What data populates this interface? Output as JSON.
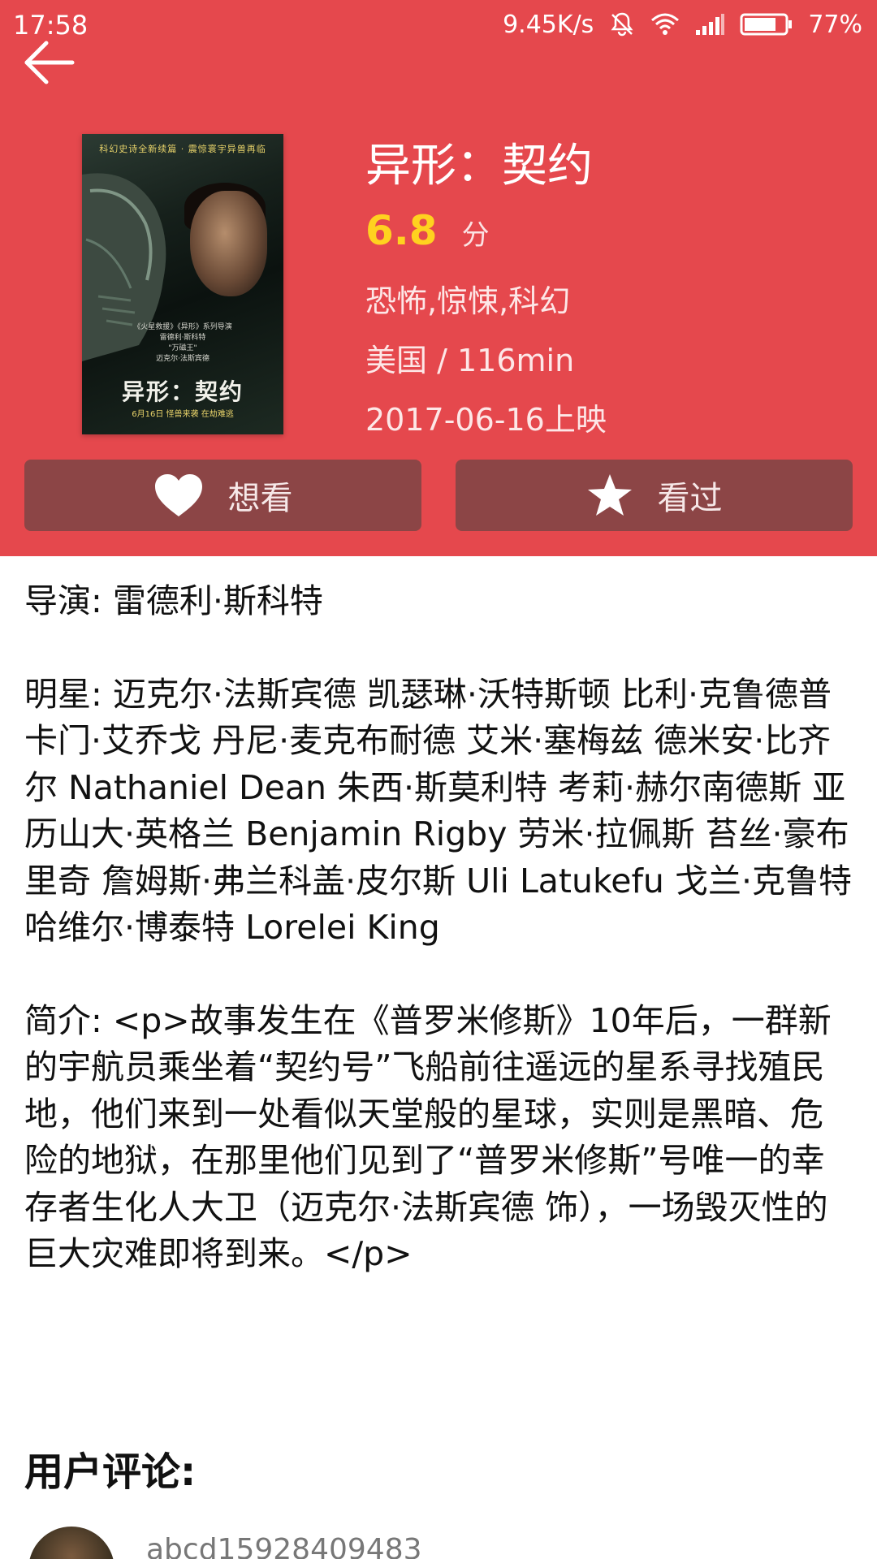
{
  "status_bar": {
    "time": "17:58",
    "net_speed": "9.45K/s",
    "battery": "77%"
  },
  "movie": {
    "title": "异形：契约",
    "rating": "6.8",
    "rating_unit": "分",
    "genres": "恐怖,惊悚,科幻",
    "country_duration": "美国 / 116min",
    "release": "2017-06-16上映"
  },
  "poster": {
    "top_text": "科幻史诗全新续篇 · 震惊寰宇异兽再临",
    "credits": "《火星救援》《异形》系列导演\n雷德利·斯科特\n\"万磁王\"\n迈克尔·法斯宾德",
    "title": "异形：契约",
    "tagline": "6月16日 怪兽来袭 在劫难逃"
  },
  "actions": {
    "want_label": "想看",
    "seen_label": "看过"
  },
  "details": {
    "director": "导演: 雷德利·斯科特",
    "stars": "明星: 迈克尔·法斯宾德 凯瑟琳·沃特斯顿 比利·克鲁德普 卡门·艾乔戈 丹尼·麦克布耐德 艾米·塞梅兹 德米安·比齐尔 Nathaniel Dean 朱西·斯莫利特 考莉·赫尔南德斯 亚历山大·英格兰 Benjamin Rigby 劳米·拉佩斯 苔丝·豪布里奇 詹姆斯·弗兰科盖·皮尔斯 Uli Latukefu 戈兰·克鲁特   哈维尔·博泰特 Lorelei King",
    "summary": "简介: <p>故事发生在《普罗米修斯》10年后，一群新的宇航员乘坐着“契约号”飞船前往遥远的星系寻找殖民地，他们来到一处看似天堂般的星球，实则是黑暗、危险的地狱，在那里他们见到了“普罗米修斯”号唯一的幸存者生化人大卫（迈克尔·法斯宾德 饰），一场毁灭性的巨大灾难即将到来。</p>"
  },
  "reviews": {
    "heading": "用户评论:",
    "items": [
      {
        "user": "abcd15928409483"
      }
    ]
  },
  "colors": {
    "header_bg": "#e5484d",
    "button_bg": "#8c4546",
    "rating": "#ffd21f"
  },
  "icons": [
    "back-arrow-icon",
    "mute-icon",
    "wifi-icon",
    "signal-icon",
    "battery-icon",
    "heart-icon",
    "star-icon"
  ]
}
